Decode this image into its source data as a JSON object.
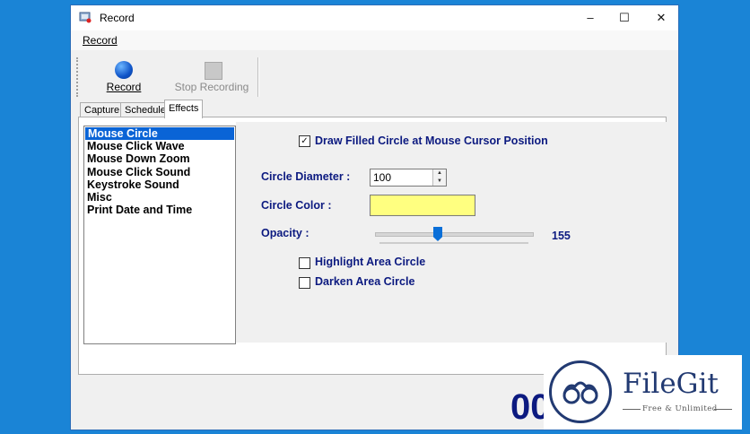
{
  "window": {
    "title": "Record"
  },
  "menu": {
    "record": "Record"
  },
  "toolbar": {
    "record_label": "Record",
    "stop_label": "Stop Recording"
  },
  "tabs": [
    "Capture",
    "Schedule",
    "Effects"
  ],
  "active_tab": "Effects",
  "effects_list": [
    "Mouse Circle",
    "Mouse Click Wave",
    "Mouse Down Zoom",
    "Mouse Click Sound",
    "Keystroke Sound",
    "Misc",
    "Print Date and Time"
  ],
  "selected_effect": "Mouse Circle",
  "settings": {
    "draw_filled_label": "Draw Filled Circle at Mouse Cursor Position",
    "draw_filled_checked": true,
    "diameter_label": "Circle Diameter :",
    "diameter_value": "100",
    "color_label": "Circle Color :",
    "color_value": "#ffff80",
    "opacity_label": "Opacity :",
    "opacity_value": "155",
    "highlight_label": "Highlight Area Circle",
    "highlight_checked": false,
    "darken_label": "Darken Area Circle",
    "darken_checked": false
  },
  "timer_partial": "00",
  "watermark": {
    "brand": "FileGit",
    "tagline": "Free & Unlimited"
  },
  "colors": {
    "accent": "#0a64d6",
    "label_blue": "#0c1a80",
    "desktop": "#1a84d6"
  }
}
